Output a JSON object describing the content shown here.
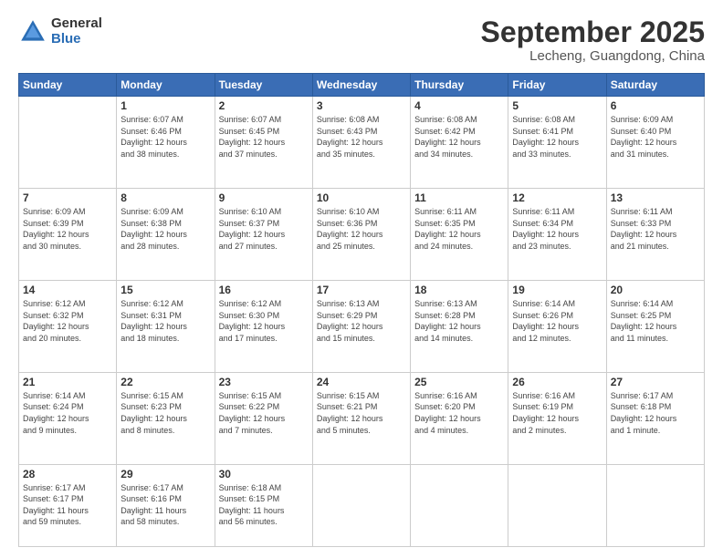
{
  "logo": {
    "general": "General",
    "blue": "Blue"
  },
  "title": "September 2025",
  "subtitle": "Lecheng, Guangdong, China",
  "headers": [
    "Sunday",
    "Monday",
    "Tuesday",
    "Wednesday",
    "Thursday",
    "Friday",
    "Saturday"
  ],
  "weeks": [
    [
      {
        "day": "",
        "info": ""
      },
      {
        "day": "1",
        "info": "Sunrise: 6:07 AM\nSunset: 6:46 PM\nDaylight: 12 hours\nand 38 minutes."
      },
      {
        "day": "2",
        "info": "Sunrise: 6:07 AM\nSunset: 6:45 PM\nDaylight: 12 hours\nand 37 minutes."
      },
      {
        "day": "3",
        "info": "Sunrise: 6:08 AM\nSunset: 6:43 PM\nDaylight: 12 hours\nand 35 minutes."
      },
      {
        "day": "4",
        "info": "Sunrise: 6:08 AM\nSunset: 6:42 PM\nDaylight: 12 hours\nand 34 minutes."
      },
      {
        "day": "5",
        "info": "Sunrise: 6:08 AM\nSunset: 6:41 PM\nDaylight: 12 hours\nand 33 minutes."
      },
      {
        "day": "6",
        "info": "Sunrise: 6:09 AM\nSunset: 6:40 PM\nDaylight: 12 hours\nand 31 minutes."
      }
    ],
    [
      {
        "day": "7",
        "info": "Sunrise: 6:09 AM\nSunset: 6:39 PM\nDaylight: 12 hours\nand 30 minutes."
      },
      {
        "day": "8",
        "info": "Sunrise: 6:09 AM\nSunset: 6:38 PM\nDaylight: 12 hours\nand 28 minutes."
      },
      {
        "day": "9",
        "info": "Sunrise: 6:10 AM\nSunset: 6:37 PM\nDaylight: 12 hours\nand 27 minutes."
      },
      {
        "day": "10",
        "info": "Sunrise: 6:10 AM\nSunset: 6:36 PM\nDaylight: 12 hours\nand 25 minutes."
      },
      {
        "day": "11",
        "info": "Sunrise: 6:11 AM\nSunset: 6:35 PM\nDaylight: 12 hours\nand 24 minutes."
      },
      {
        "day": "12",
        "info": "Sunrise: 6:11 AM\nSunset: 6:34 PM\nDaylight: 12 hours\nand 23 minutes."
      },
      {
        "day": "13",
        "info": "Sunrise: 6:11 AM\nSunset: 6:33 PM\nDaylight: 12 hours\nand 21 minutes."
      }
    ],
    [
      {
        "day": "14",
        "info": "Sunrise: 6:12 AM\nSunset: 6:32 PM\nDaylight: 12 hours\nand 20 minutes."
      },
      {
        "day": "15",
        "info": "Sunrise: 6:12 AM\nSunset: 6:31 PM\nDaylight: 12 hours\nand 18 minutes."
      },
      {
        "day": "16",
        "info": "Sunrise: 6:12 AM\nSunset: 6:30 PM\nDaylight: 12 hours\nand 17 minutes."
      },
      {
        "day": "17",
        "info": "Sunrise: 6:13 AM\nSunset: 6:29 PM\nDaylight: 12 hours\nand 15 minutes."
      },
      {
        "day": "18",
        "info": "Sunrise: 6:13 AM\nSunset: 6:28 PM\nDaylight: 12 hours\nand 14 minutes."
      },
      {
        "day": "19",
        "info": "Sunrise: 6:14 AM\nSunset: 6:26 PM\nDaylight: 12 hours\nand 12 minutes."
      },
      {
        "day": "20",
        "info": "Sunrise: 6:14 AM\nSunset: 6:25 PM\nDaylight: 12 hours\nand 11 minutes."
      }
    ],
    [
      {
        "day": "21",
        "info": "Sunrise: 6:14 AM\nSunset: 6:24 PM\nDaylight: 12 hours\nand 9 minutes."
      },
      {
        "day": "22",
        "info": "Sunrise: 6:15 AM\nSunset: 6:23 PM\nDaylight: 12 hours\nand 8 minutes."
      },
      {
        "day": "23",
        "info": "Sunrise: 6:15 AM\nSunset: 6:22 PM\nDaylight: 12 hours\nand 7 minutes."
      },
      {
        "day": "24",
        "info": "Sunrise: 6:15 AM\nSunset: 6:21 PM\nDaylight: 12 hours\nand 5 minutes."
      },
      {
        "day": "25",
        "info": "Sunrise: 6:16 AM\nSunset: 6:20 PM\nDaylight: 12 hours\nand 4 minutes."
      },
      {
        "day": "26",
        "info": "Sunrise: 6:16 AM\nSunset: 6:19 PM\nDaylight: 12 hours\nand 2 minutes."
      },
      {
        "day": "27",
        "info": "Sunrise: 6:17 AM\nSunset: 6:18 PM\nDaylight: 12 hours\nand 1 minute."
      }
    ],
    [
      {
        "day": "28",
        "info": "Sunrise: 6:17 AM\nSunset: 6:17 PM\nDaylight: 11 hours\nand 59 minutes."
      },
      {
        "day": "29",
        "info": "Sunrise: 6:17 AM\nSunset: 6:16 PM\nDaylight: 11 hours\nand 58 minutes."
      },
      {
        "day": "30",
        "info": "Sunrise: 6:18 AM\nSunset: 6:15 PM\nDaylight: 11 hours\nand 56 minutes."
      },
      {
        "day": "",
        "info": ""
      },
      {
        "day": "",
        "info": ""
      },
      {
        "day": "",
        "info": ""
      },
      {
        "day": "",
        "info": ""
      }
    ]
  ]
}
